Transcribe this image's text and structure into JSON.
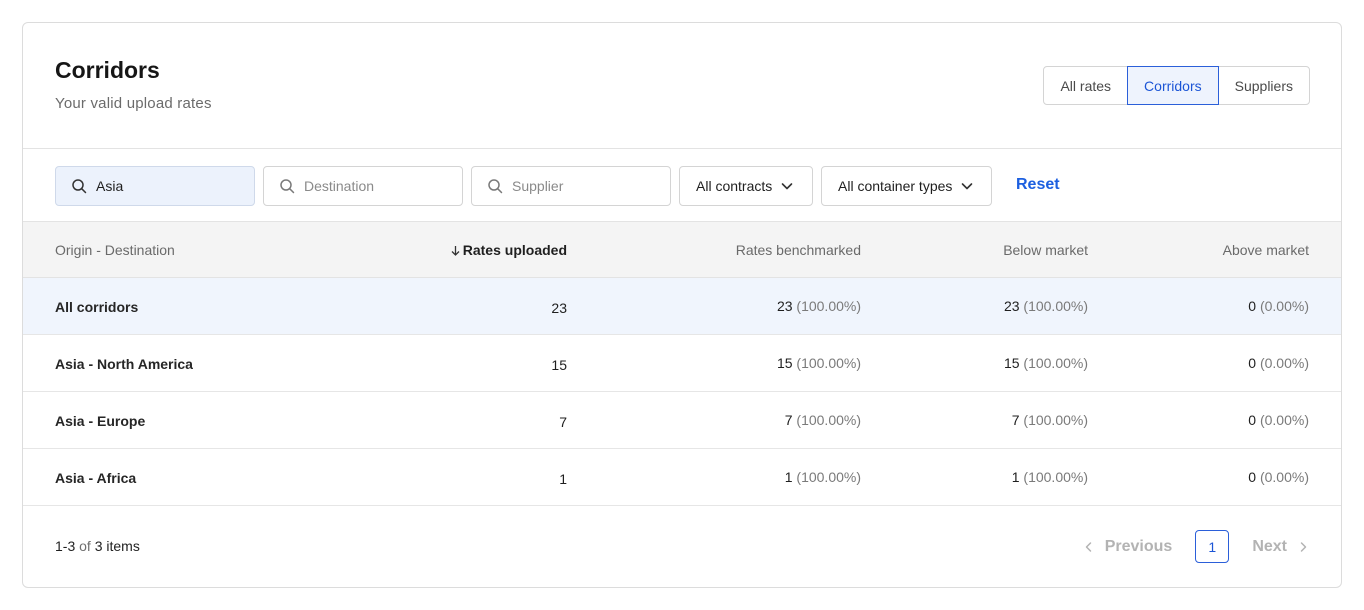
{
  "header": {
    "title": "Corridors",
    "subtitle": "Your valid upload rates",
    "tabs": [
      {
        "label": "All rates",
        "active": false
      },
      {
        "label": "Corridors",
        "active": true
      },
      {
        "label": "Suppliers",
        "active": false
      }
    ]
  },
  "filters": {
    "origin": {
      "value": "Asia",
      "icon": "search-icon"
    },
    "destination": {
      "placeholder": "Destination",
      "icon": "search-icon"
    },
    "supplier": {
      "placeholder": "Supplier",
      "icon": "search-icon"
    },
    "contracts": {
      "selected": "All contracts",
      "icon": "chevron-down-icon"
    },
    "container_types": {
      "selected": "All container types",
      "icon": "chevron-down-icon"
    },
    "reset_label": "Reset"
  },
  "table": {
    "columns": {
      "origin_destination": "Origin - Destination",
      "rates_uploaded": "Rates uploaded",
      "rates_benchmarked": "Rates benchmarked",
      "below_market": "Below market",
      "above_market": "Above market"
    },
    "sort": {
      "column": "rates_uploaded",
      "direction": "desc",
      "icon": "arrow-down-icon"
    },
    "rows": [
      {
        "name": "All corridors",
        "uploaded": "23",
        "bench": "23",
        "bench_pct": "(100.00%)",
        "below": "23",
        "below_pct": "(100.00%)",
        "above": "0",
        "above_pct": "(0.00%)"
      },
      {
        "name": "Asia - North America",
        "uploaded": "15",
        "bench": "15",
        "bench_pct": "(100.00%)",
        "below": "15",
        "below_pct": "(100.00%)",
        "above": "0",
        "above_pct": "(0.00%)"
      },
      {
        "name": "Asia - Europe",
        "uploaded": "7",
        "bench": "7",
        "bench_pct": "(100.00%)",
        "below": "7",
        "below_pct": "(100.00%)",
        "above": "0",
        "above_pct": "(0.00%)"
      },
      {
        "name": "Asia - Africa",
        "uploaded": "1",
        "bench": "1",
        "bench_pct": "(100.00%)",
        "below": "1",
        "below_pct": "(100.00%)",
        "above": "0",
        "above_pct": "(0.00%)"
      }
    ]
  },
  "footer": {
    "range": "1-3",
    "of_word": "of",
    "total": "3 items",
    "previous_label": "Previous",
    "next_label": "Next",
    "current_page": "1"
  },
  "colors": {
    "accent": "#1c55d6",
    "highlight_row": "#f0f5fd",
    "header_bg": "#f4f4f4"
  }
}
